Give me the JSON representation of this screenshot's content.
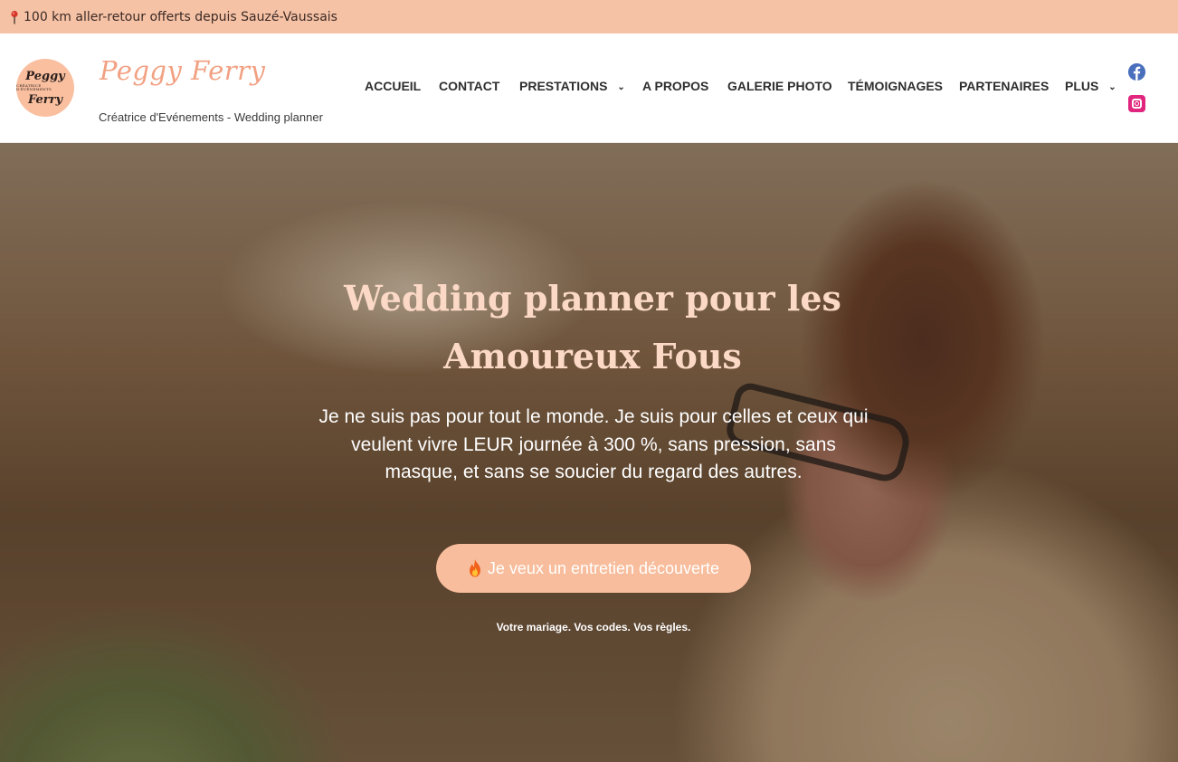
{
  "topbar": {
    "text": "100 km aller-retour offerts depuis Sauzé-Vaussais",
    "icon": "map-pin-icon"
  },
  "brand": {
    "logo_line1": "Peggy",
    "logo_line2": "CRÉATRICE D'ÉVÉNEMENTS",
    "logo_line3": "Ferry",
    "name": "Peggy Ferry",
    "tagline": "Créatrice d'Evénements - Wedding planner"
  },
  "nav": {
    "items": [
      {
        "label": "ACCUEIL",
        "has_dropdown": false
      },
      {
        "label": "CONTACT",
        "has_dropdown": false
      },
      {
        "label": "PRESTATIONS",
        "has_dropdown": true
      },
      {
        "label": "A PROPOS",
        "has_dropdown": false
      },
      {
        "label": "GALERIE PHOTO",
        "has_dropdown": false
      },
      {
        "label": "TÉMOIGNAGES",
        "has_dropdown": false
      },
      {
        "label": "PARTENAIRES",
        "has_dropdown": false
      },
      {
        "label": "PLUS",
        "has_dropdown": true
      }
    ],
    "chevron": "⌄"
  },
  "social": {
    "facebook_icon": "facebook-icon",
    "instagram_icon": "instagram-icon",
    "facebook_color": "#4a6fbd",
    "instagram_color": "#e0267e"
  },
  "hero": {
    "title": "Wedding planner pour les Amoureux Fous",
    "intro": "Je ne suis pas pour tout le monde. Je suis pour celles et ceux qui veulent vivre LEUR journée à 300 %, sans pression, sans masque, et sans se soucier du regard des autres.",
    "cta_label": "Je veux un entretien découverte",
    "cta_icon": "fire-icon",
    "tagline": "Votre mariage. Vos codes. Vos règles."
  },
  "colors": {
    "accent": "#f6c2a5",
    "brand_text": "#f2a183",
    "title": "#fbd9c6",
    "button": "#f8bd9c"
  }
}
